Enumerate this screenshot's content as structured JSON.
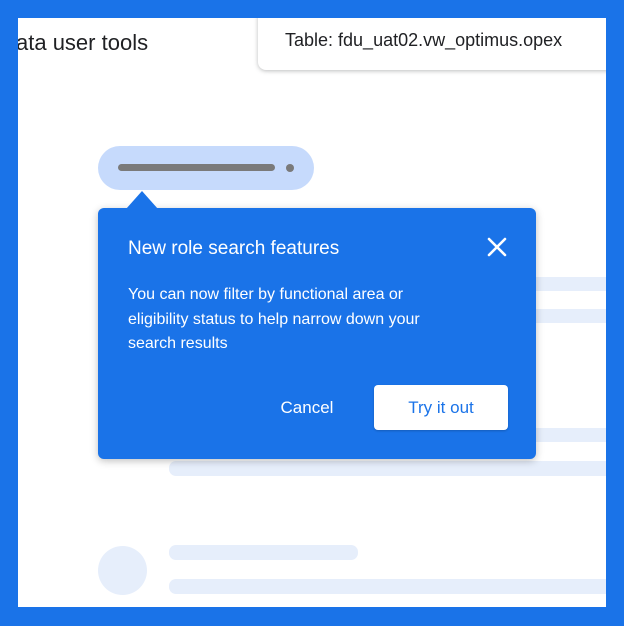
{
  "header": {
    "app_title": "ata user tools",
    "table_label": "Table: fdu_uat02.vw_optimus.opex"
  },
  "popover": {
    "title": "New role search features",
    "body": "You can now filter by functional area or eligibility status to help narrow down your search results",
    "close_icon": "close-icon",
    "cancel_label": "Cancel",
    "primary_label": "Try it out"
  },
  "colors": {
    "accent": "#1a73e8",
    "pill_fill": "#c6dafc",
    "skeleton": "#e6eefb",
    "text": "#202124"
  }
}
